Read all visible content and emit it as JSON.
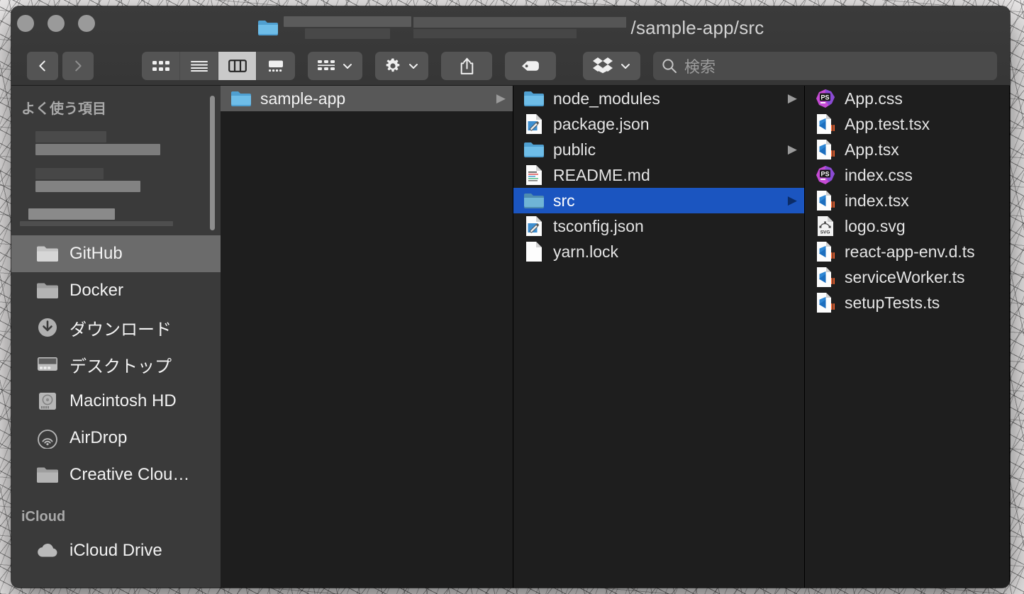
{
  "window": {
    "title_path": "/sample-app/src",
    "traffic_lights": [
      "close",
      "minimize",
      "zoom"
    ],
    "title_redacted": true
  },
  "toolbar": {
    "back_label": "‹",
    "forward_label": "›",
    "views": [
      {
        "name": "icon-view",
        "label": "",
        "active": false
      },
      {
        "name": "list-view",
        "label": "",
        "active": false
      },
      {
        "name": "column-view",
        "label": "",
        "active": true
      },
      {
        "name": "gallery-view",
        "label": "",
        "active": false
      }
    ],
    "group_by_label": "",
    "action_label": "",
    "share_label": "",
    "tag_label": "",
    "dropbox_label": "",
    "search": {
      "placeholder": "検索",
      "value": ""
    }
  },
  "sidebar": {
    "sections": [
      {
        "header": "よく使う項目",
        "items": [
          {
            "label": "",
            "icon": "redacted",
            "redacted": true,
            "selected": false
          },
          {
            "label": "",
            "icon": "redacted",
            "redacted": true,
            "selected": false
          },
          {
            "label": "",
            "icon": "redacted",
            "redacted": true,
            "selected": false
          },
          {
            "label": "GitHub",
            "icon": "folder-icon",
            "selected": true
          },
          {
            "label": "Docker",
            "icon": "folder-icon",
            "selected": false
          },
          {
            "label": "ダウンロード",
            "icon": "downloads-icon",
            "selected": false
          },
          {
            "label": "デスクトップ",
            "icon": "desktop-icon",
            "selected": false
          },
          {
            "label": "Macintosh HD",
            "icon": "harddisk-icon",
            "selected": false
          },
          {
            "label": "AirDrop",
            "icon": "airdrop-icon",
            "selected": false
          },
          {
            "label": "Creative Clou…",
            "icon": "folder-icon",
            "selected": false
          }
        ]
      },
      {
        "header": "iCloud",
        "items": [
          {
            "label": "iCloud Drive",
            "icon": "cloud-icon",
            "selected": false
          }
        ]
      }
    ]
  },
  "columns": [
    {
      "name": "column-1",
      "items": [
        {
          "label": "sample-app",
          "icon": "folder-icon",
          "has_children": true,
          "selected": "gray"
        }
      ]
    },
    {
      "name": "column-2",
      "items": [
        {
          "label": "node_modules",
          "icon": "folder-icon",
          "has_children": true,
          "selected": "none"
        },
        {
          "label": "package.json",
          "icon": "json-icon",
          "has_children": false,
          "selected": "none"
        },
        {
          "label": "public",
          "icon": "folder-icon",
          "has_children": true,
          "selected": "none"
        },
        {
          "label": "README.md",
          "icon": "markdown-icon",
          "has_children": false,
          "selected": "none"
        },
        {
          "label": "src",
          "icon": "folder-icon",
          "has_children": true,
          "selected": "blue"
        },
        {
          "label": "tsconfig.json",
          "icon": "json-icon",
          "has_children": false,
          "selected": "none"
        },
        {
          "label": "yarn.lock",
          "icon": "plain-doc-icon",
          "has_children": false,
          "selected": "none"
        }
      ]
    },
    {
      "name": "column-3",
      "items": [
        {
          "label": "App.css",
          "icon": "phpstorm-css-icon",
          "has_children": false,
          "selected": "none"
        },
        {
          "label": "App.test.tsx",
          "icon": "vscode-icon",
          "has_children": false,
          "selected": "none"
        },
        {
          "label": "App.tsx",
          "icon": "vscode-icon",
          "has_children": false,
          "selected": "none"
        },
        {
          "label": "index.css",
          "icon": "phpstorm-css-icon",
          "has_children": false,
          "selected": "none"
        },
        {
          "label": "index.tsx",
          "icon": "vscode-icon",
          "has_children": false,
          "selected": "none"
        },
        {
          "label": "logo.svg",
          "icon": "svg-icon",
          "has_children": false,
          "selected": "none"
        },
        {
          "label": "react-app-env.d.ts",
          "icon": "vscode-icon",
          "has_children": false,
          "selected": "none"
        },
        {
          "label": "serviceWorker.ts",
          "icon": "vscode-icon",
          "has_children": false,
          "selected": "none"
        },
        {
          "label": "setupTests.ts",
          "icon": "vscode-icon",
          "has_children": false,
          "selected": "none"
        }
      ]
    }
  ],
  "colors": {
    "selection_blue": "#1b55c0",
    "selection_gray": "#585858",
    "titlebar": "#383838",
    "sidebar": "#3a3a3a",
    "column_bg": "#1e1e1e",
    "folder_blue": "#5ea8d8"
  }
}
